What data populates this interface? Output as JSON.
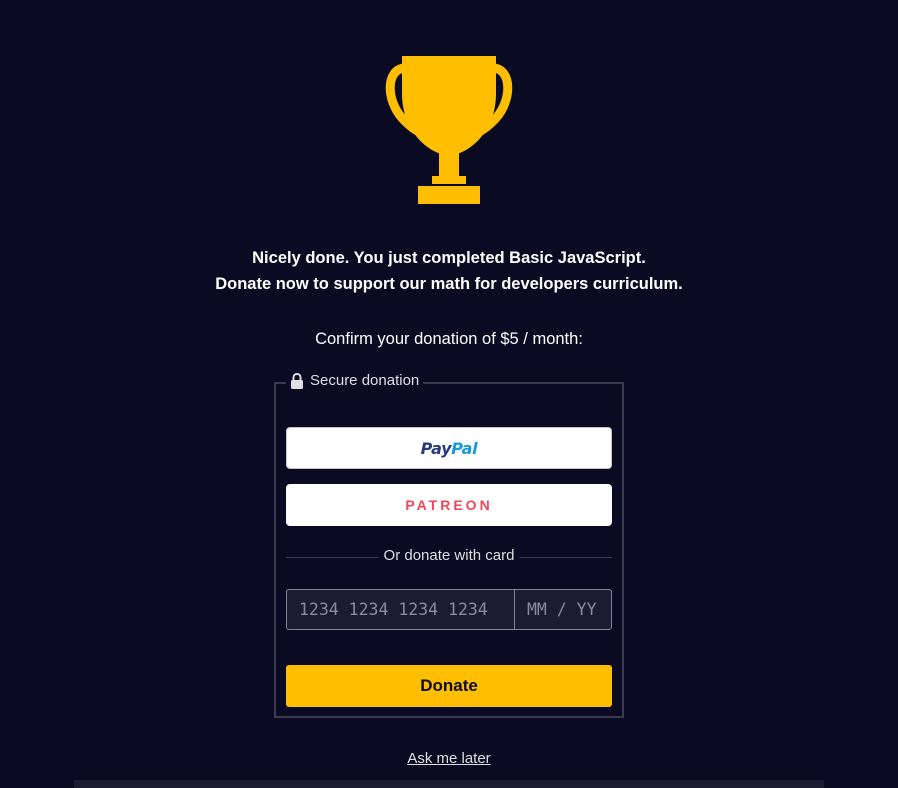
{
  "modal": {
    "headline_line1": "Nicely done. You just completed Basic JavaScript.",
    "headline_line2": "Donate now to support our math for developers curriculum.",
    "confirm_text": "Confirm your donation of $5 / month:"
  },
  "donation_box": {
    "legend": "Secure donation",
    "paypal": {
      "part1": "Pay",
      "part2": "Pal"
    },
    "patreon_label": "PATREON",
    "divider_text": "Or donate with card",
    "card_number_placeholder": "1234 1234 1234 1234",
    "expiry_placeholder": "MM / YY",
    "donate_label": "Donate"
  },
  "ask_later": "Ask me later",
  "colors": {
    "background": "#0a0a23",
    "accent": "#ffbf00",
    "patreon": "#f1465a",
    "paypal_dark": "#253b80",
    "paypal_light": "#179bd7"
  },
  "icons": {
    "trophy": "trophy-icon",
    "lock": "lock-icon"
  }
}
